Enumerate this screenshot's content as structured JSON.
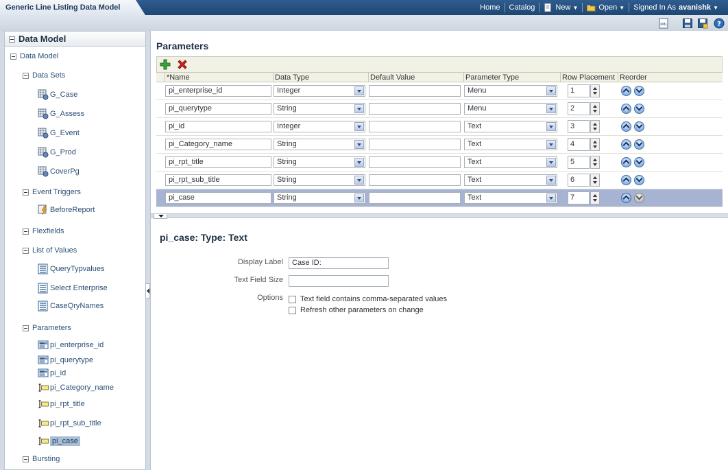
{
  "app": {
    "title": "Generic Line Listing Data Model",
    "nav": {
      "home": "Home",
      "catalog": "Catalog",
      "new": "New",
      "open": "Open",
      "signed_in_as": "Signed In As",
      "user": "avanishk"
    }
  },
  "sidebar": {
    "header": "Data Model",
    "root": "Data Model",
    "groups": {
      "data_sets": "Data Sets",
      "event_triggers": "Event Triggers",
      "flexfields": "Flexfields",
      "lov": "List of Values",
      "parameters": "Parameters",
      "bursting": "Bursting"
    },
    "data_sets": [
      "G_Case",
      "G_Assess",
      "G_Event",
      "G_Prod",
      "CoverPg"
    ],
    "event_triggers": [
      "BeforeReport"
    ],
    "lov": [
      "QueryTypvalues",
      "Select Enterprise",
      "CaseQryNames"
    ],
    "parameters": [
      "pi_enterprise_id",
      "pi_querytype",
      "pi_id",
      "pi_Category_name",
      "pi_rpt_title",
      "pi_rpt_sub_title",
      "pi_case"
    ]
  },
  "main": {
    "title": "Parameters",
    "columns": {
      "name": "*Name",
      "data_type": "Data Type",
      "default_value": "Default Value",
      "param_type": "Parameter Type",
      "row_placement": "Row Placement",
      "reorder": "Reorder"
    },
    "rows": [
      {
        "name": "pi_enterprise_id",
        "data_type": "Integer",
        "default": "",
        "param_type": "Menu",
        "placement": "1"
      },
      {
        "name": "pi_querytype",
        "data_type": "String",
        "default": "",
        "param_type": "Menu",
        "placement": "2"
      },
      {
        "name": "pi_id",
        "data_type": "Integer",
        "default": "",
        "param_type": "Text",
        "placement": "3"
      },
      {
        "name": "pi_Category_name",
        "data_type": "String",
        "default": "",
        "param_type": "Text",
        "placement": "4"
      },
      {
        "name": "pi_rpt_title",
        "data_type": "String",
        "default": "",
        "param_type": "Text",
        "placement": "5"
      },
      {
        "name": "pi_rpt_sub_title",
        "data_type": "String",
        "default": "",
        "param_type": "Text",
        "placement": "6"
      },
      {
        "name": "pi_case",
        "data_type": "String",
        "default": "",
        "param_type": "Text",
        "placement": "7"
      }
    ],
    "selected_row": 6
  },
  "detail": {
    "title": "pi_case: Type: Text",
    "display_label_label": "Display Label",
    "display_label_value": "Case ID:",
    "text_field_size_label": "Text Field Size",
    "text_field_size_value": "",
    "options_label": "Options",
    "option_1": "Text field contains comma-separated values",
    "option_2": "Refresh other parameters on change"
  },
  "icons": {
    "add": "plus-icon",
    "delete": "x-icon",
    "xml": "xml-icon",
    "save": "save-icon",
    "save_as": "save-as-icon",
    "help": "help-icon"
  },
  "colors": {
    "topbar": "#1e4672",
    "selected_row": "#a7b3d3",
    "link": "#2c4f77"
  }
}
